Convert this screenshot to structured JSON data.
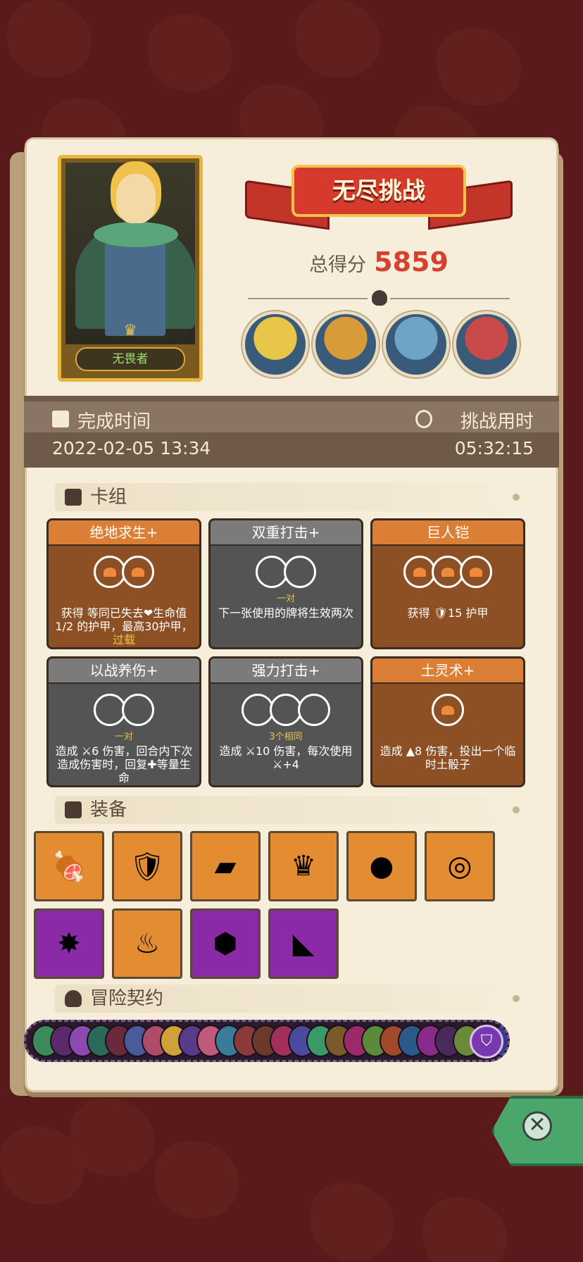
{
  "hero": {
    "name": "无畏者"
  },
  "mode_title": "无尽挑战",
  "score": {
    "label": "总得分",
    "value": "5859"
  },
  "bosses": [
    "#e7c64a",
    "#d99a3a",
    "#6fa5c4",
    "#c84a4a"
  ],
  "time": {
    "finish_label": "完成时间",
    "duration_label": "挑战用时",
    "finish_value": "2022-02-05 13:34",
    "duration_value": "05:32:15"
  },
  "sections": {
    "deck": "卡组",
    "equipment": "装备",
    "contracts": "冒险契约"
  },
  "cards": [
    {
      "title": "绝地求生+",
      "color": "orange",
      "cost": 2,
      "sub": "",
      "desc": "获得 等同已失去❤生命值1/2 的护甲，最高30护甲，",
      "desc_hl": "过载"
    },
    {
      "title": "双重打击+",
      "color": "gray",
      "cost": 2,
      "sub": "一对",
      "desc": "下一张使用的牌将生效两次",
      "desc_hl": ""
    },
    {
      "title": "巨人铠",
      "color": "orange",
      "cost": 3,
      "sub": "",
      "desc": "获得 🛡15 护甲",
      "desc_hl": ""
    },
    {
      "title": "以战养伤+",
      "color": "gray",
      "cost": 2,
      "sub": "一对",
      "desc": "造成 ⚔6 伤害，回合内下次造成伤害时，回复✚等量生命",
      "desc_hl": ""
    },
    {
      "title": "强力打击+",
      "color": "gray",
      "cost": 3,
      "sub": "3个相同",
      "desc": "造成 ⚔10 伤害，每次使用 ⚔+4",
      "desc_hl": ""
    },
    {
      "title": "土灵术+",
      "color": "orange",
      "cost": 1,
      "sub": "",
      "desc": "造成 ▲8 伤害，投出一个临时土骰子",
      "desc_hl": ""
    }
  ],
  "equipment": [
    {
      "name": "meat-icon",
      "color": "orange",
      "glyph": "🍖"
    },
    {
      "name": "shield-face-icon",
      "color": "orange",
      "glyph": "🛡"
    },
    {
      "name": "moss-stone-icon",
      "color": "orange",
      "glyph": "▰"
    },
    {
      "name": "crown-icon",
      "color": "orange",
      "glyph": "♛"
    },
    {
      "name": "blue-stones-icon",
      "color": "orange",
      "glyph": "●"
    },
    {
      "name": "ring-plate-icon",
      "color": "orange",
      "glyph": "◎"
    },
    {
      "name": "dark-cube-icon",
      "color": "purple",
      "glyph": "✸"
    },
    {
      "name": "flame-icon",
      "color": "orange",
      "glyph": "♨"
    },
    {
      "name": "gold-gem-icon",
      "color": "purple",
      "glyph": "⬢"
    },
    {
      "name": "cheese-icon",
      "color": "purple",
      "glyph": "◣"
    }
  ],
  "contract_colors": [
    "#3a8a5a",
    "#5a2a6a",
    "#8a4ab0",
    "#2a6a5a",
    "#6a2a3a",
    "#4a5a9a",
    "#b04a6a",
    "#d0a03a",
    "#5a3a8a",
    "#c05a7a",
    "#3a7a9a",
    "#8a3a3a",
    "#6a3a2a",
    "#a0305a",
    "#4a4aa0",
    "#3a9a6a",
    "#7a5a2a",
    "#9a2a6a",
    "#5a8a3a",
    "#a04a2a",
    "#2a5a8a",
    "#8a2a8a",
    "#4a2a5a",
    "#6a8a3a",
    "#aa3a3a",
    "#3a3a8a",
    "#7a2a5a",
    "#2a8a8a"
  ]
}
